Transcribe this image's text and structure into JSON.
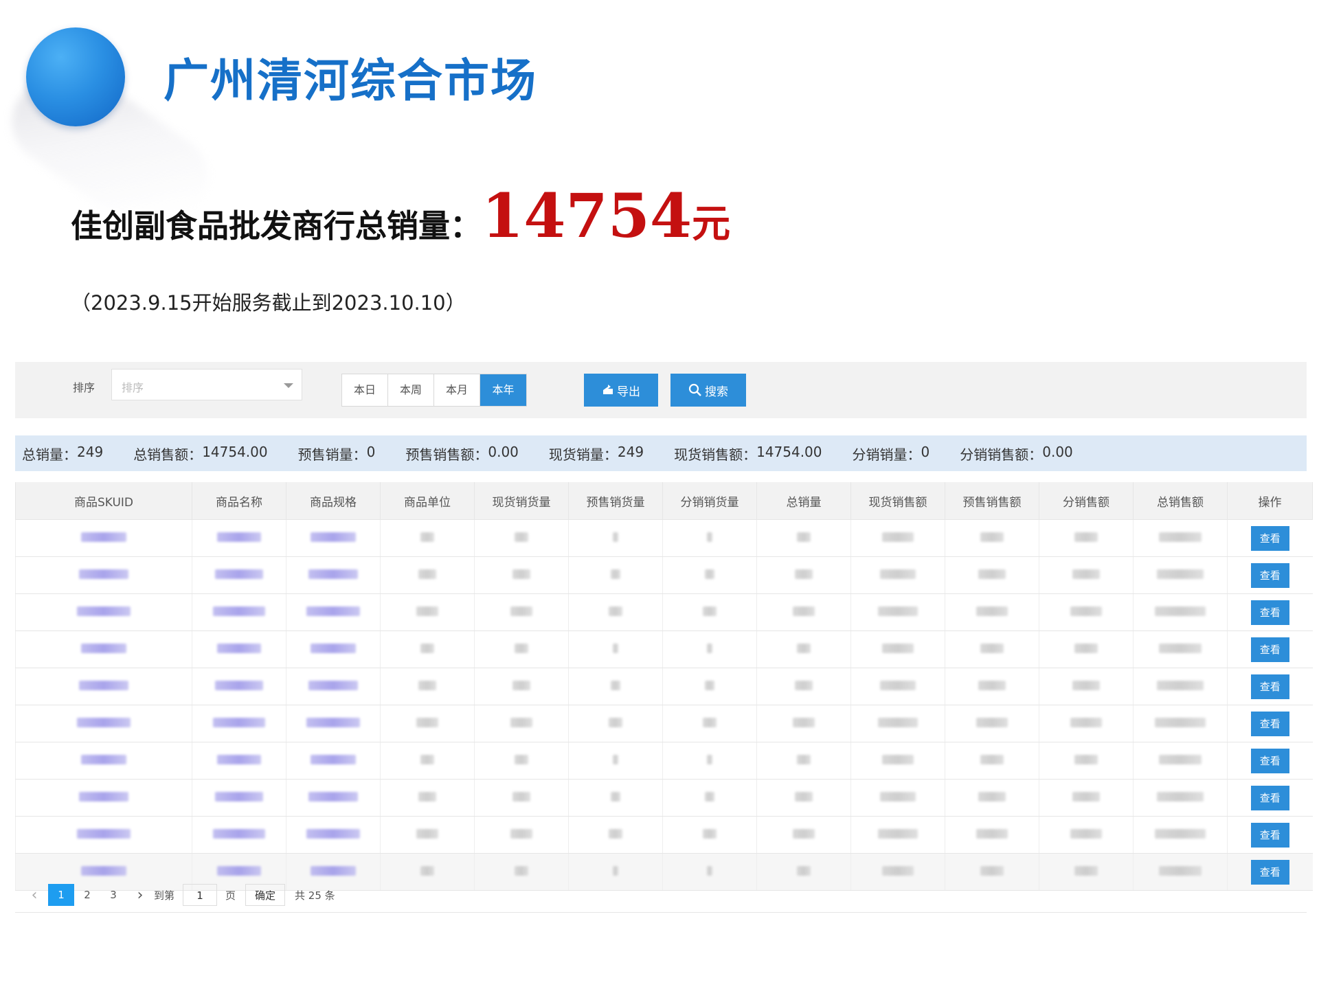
{
  "header": {
    "market_title": "广州清河综合市场",
    "sales_label": "佳创副食品批发商行总销量：",
    "sales_value": "14754",
    "sales_unit": "元",
    "period": "（2023.9.15开始服务截止到2023.10.10）"
  },
  "filter": {
    "sort_label": "排序",
    "sort_placeholder": "排序",
    "periods": [
      "本日",
      "本周",
      "本月",
      "本年"
    ],
    "active_period": "本年",
    "export_label": "导出",
    "search_label": "搜索"
  },
  "summary": [
    {
      "label": "总销量：",
      "value": "249"
    },
    {
      "label": "总销售额：",
      "value": "14754.00"
    },
    {
      "label": "预售销量：",
      "value": "0"
    },
    {
      "label": "预售销售额：",
      "value": "0.00"
    },
    {
      "label": "现货销量：",
      "value": "249"
    },
    {
      "label": "现货销售额：",
      "value": "14754.00"
    },
    {
      "label": "分销销量：",
      "value": "0"
    },
    {
      "label": "分销销售额：",
      "value": "0.00"
    }
  ],
  "table": {
    "columns": [
      "商品SKUID",
      "商品名称",
      "商品规格",
      "商品单位",
      "现货销货量",
      "预售销货量",
      "分销销货量",
      "总销量",
      "现货销售额",
      "预售销售额",
      "分销售额",
      "总销售额",
      "操作"
    ],
    "action_label": "查看",
    "row_count": 10
  },
  "pagination": {
    "prev_icon": "chevron-left-icon",
    "pages": [
      "1",
      "2",
      "3"
    ],
    "current_page": "1",
    "next_icon": "chevron-right-icon",
    "goto_label": "到第",
    "goto_value": "1",
    "page_unit": "页",
    "confirm_label": "确定",
    "total_label": "共 25 条"
  },
  "colors": {
    "brand_blue": "#2d8ed9",
    "title_blue": "#1670c8",
    "sales_red": "#c41010",
    "summary_bg": "#dde9f6"
  }
}
